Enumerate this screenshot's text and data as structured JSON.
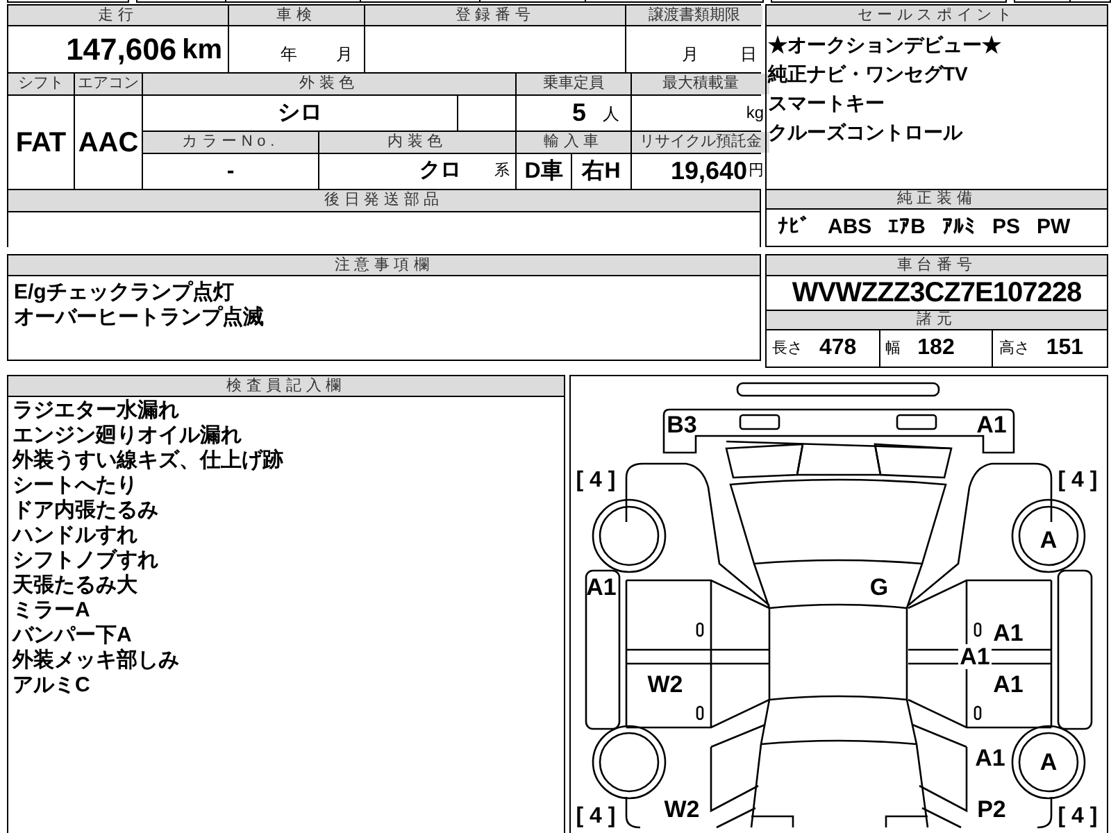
{
  "vehicle_info": {
    "mileage": {
      "label": "走行",
      "value": "147,606",
      "unit": "km"
    },
    "inspection": {
      "label": "車検",
      "year_unit": "年",
      "month_unit": "月"
    },
    "registration_number": {
      "label": "登録番号"
    },
    "document_deadline": {
      "label": "譲渡書類期限",
      "month_unit": "月",
      "day_unit": "日"
    },
    "shift": {
      "label": "シフト",
      "value": "FAT"
    },
    "air_conditioner": {
      "label": "エアコン",
      "value": "AAC"
    },
    "exterior_color": {
      "label": "外装色",
      "value": "シロ"
    },
    "capacity": {
      "label": "乗車定員",
      "value": "5",
      "unit": "人"
    },
    "max_load": {
      "label": "最大積載量",
      "unit": "kg"
    },
    "color_number": {
      "label": "カラーNo.",
      "value": "-"
    },
    "interior_color": {
      "label": "内装色",
      "value": "クロ",
      "unit": "系"
    },
    "import": {
      "label": "輸入車",
      "dealer": "D車",
      "steering": "右H"
    },
    "recycling_fee": {
      "label": "リサイクル預託金",
      "value": "19,640",
      "unit": "円"
    },
    "later_parts": {
      "label": "後日発送部品"
    }
  },
  "sales_points": {
    "label": "セールスポイント",
    "items": [
      "★オークションデビュー★",
      "純正ナビ・ワンセグTV",
      "スマートキー",
      "クルーズコントロール"
    ]
  },
  "standard_equipment": {
    "label": "純正装備",
    "items": [
      "ﾅﾋﾞ",
      "ABS",
      "ｴｱB",
      "ｱﾙﾐ",
      "PS",
      "PW"
    ]
  },
  "notes": {
    "label": "注意事項欄",
    "lines": [
      "E/gチェックランプ点灯",
      "オーバーヒートランプ点滅"
    ]
  },
  "chassis": {
    "label": "車台番号",
    "value": "WVWZZZ3CZ7E107228"
  },
  "specs": {
    "label": "諸元",
    "items": [
      {
        "label": "長さ",
        "value": "478"
      },
      {
        "label": "幅",
        "value": "182"
      },
      {
        "label": "高さ",
        "value": "151"
      }
    ]
  },
  "inspector": {
    "label": "検査員記入欄",
    "lines": [
      "ラジエター水漏れ",
      "エンジン廻りオイル漏れ",
      "外装うすい線キズ、仕上げ跡",
      "シートへたり",
      "ドア内張たるみ",
      "ハンドルすれ",
      "シフトノブすれ",
      "天張たるみ大",
      "ミラーA",
      "バンパー下A",
      "外装メッキ部しみ",
      "アルミC"
    ]
  },
  "diagram": {
    "marks": [
      {
        "kind": "damage",
        "text": "B3"
      },
      {
        "kind": "damage",
        "text": "A1"
      },
      {
        "kind": "tread",
        "text": "[ 4 ]"
      },
      {
        "kind": "tread",
        "text": "[ 4 ]"
      },
      {
        "kind": "damage",
        "text": "A"
      },
      {
        "kind": "damage",
        "text": "A1"
      },
      {
        "kind": "damage",
        "text": "G"
      },
      {
        "kind": "damage",
        "text": "A1"
      },
      {
        "kind": "damage",
        "text": "A1"
      },
      {
        "kind": "damage",
        "text": "W2"
      },
      {
        "kind": "damage",
        "text": "A1"
      },
      {
        "kind": "damage",
        "text": "A1"
      },
      {
        "kind": "damage",
        "text": "A"
      },
      {
        "kind": "tread",
        "text": "[ 4 ]"
      },
      {
        "kind": "damage",
        "text": "W2"
      },
      {
        "kind": "damage",
        "text": "P2"
      },
      {
        "kind": "tread",
        "text": "[ 4 ]"
      }
    ]
  }
}
